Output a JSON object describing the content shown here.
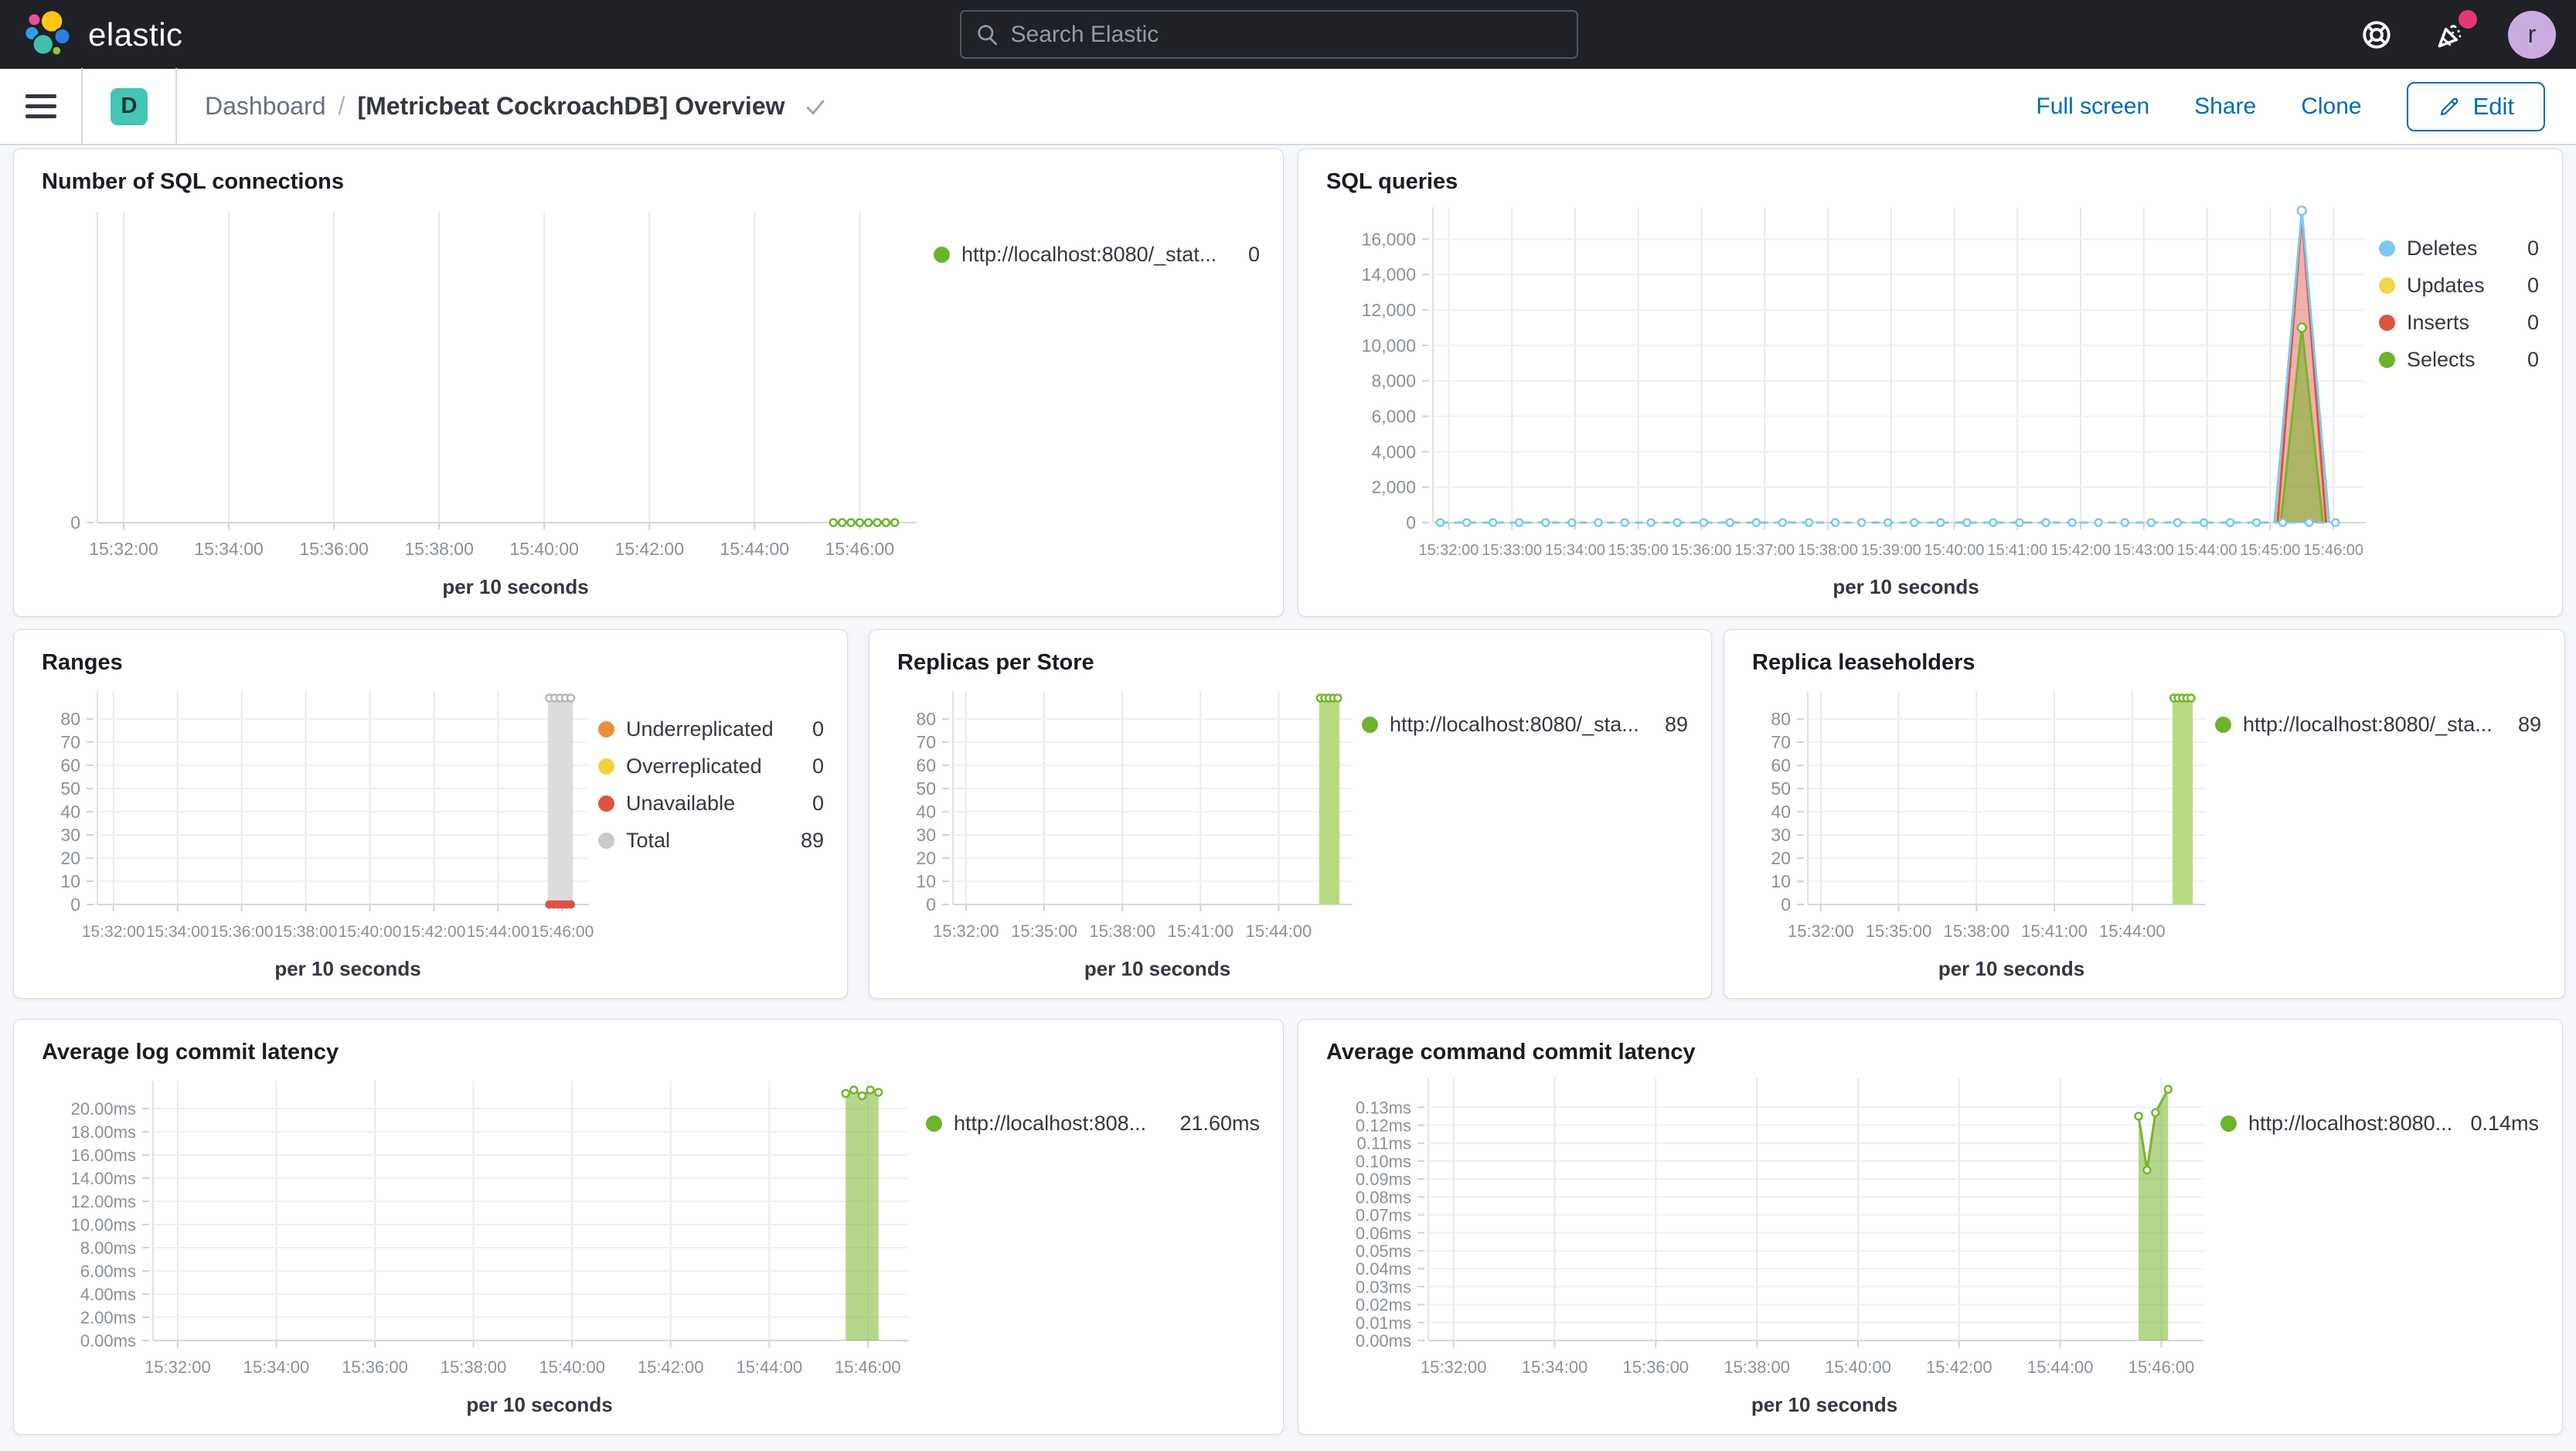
{
  "topbar": {
    "brand": "elastic",
    "search_placeholder": "Search Elastic",
    "avatar_initial": "r"
  },
  "navbar": {
    "space_initial": "D",
    "breadcrumb_root": "Dashboard",
    "breadcrumb_separator": "/",
    "title": "[Metricbeat CockroachDB] Overview",
    "actions": {
      "full_screen": "Full screen",
      "share": "Share",
      "clone": "Clone",
      "edit": "Edit"
    }
  },
  "panels": [
    {
      "id": "sql_connections",
      "title": "Number of SQL connections",
      "xlabel": "per 10 seconds",
      "legend": [
        {
          "label": "http://localhost:8080/_stat...",
          "value": "0",
          "color": "#6db32c"
        }
      ]
    },
    {
      "id": "sql_queries",
      "title": "SQL queries",
      "xlabel": "per 10 seconds",
      "legend": [
        {
          "label": "Deletes",
          "value": "0",
          "color": "#7dc8ee"
        },
        {
          "label": "Updates",
          "value": "0",
          "color": "#efd54b"
        },
        {
          "label": "Inserts",
          "value": "0",
          "color": "#dd5244"
        },
        {
          "label": "Selects",
          "value": "0",
          "color": "#6db32c"
        }
      ]
    },
    {
      "id": "ranges",
      "title": "Ranges",
      "xlabel": "per 10 seconds",
      "legend": [
        {
          "label": "Underreplicated",
          "value": "0",
          "color": "#e8913c"
        },
        {
          "label": "Overreplicated",
          "value": "0",
          "color": "#f0d33b"
        },
        {
          "label": "Unavailable",
          "value": "0",
          "color": "#dd5244"
        },
        {
          "label": "Total",
          "value": "89",
          "color": "#c9c9c9"
        }
      ]
    },
    {
      "id": "replicas_per_store",
      "title": "Replicas per Store",
      "xlabel": "per 10 seconds",
      "legend": [
        {
          "label": "http://localhost:8080/_sta...",
          "value": "89",
          "color": "#6db32c"
        }
      ]
    },
    {
      "id": "replica_leaseholders",
      "title": "Replica leaseholders",
      "xlabel": "per 10 seconds",
      "legend": [
        {
          "label": "http://localhost:8080/_sta...",
          "value": "89",
          "color": "#6db32c"
        }
      ]
    },
    {
      "id": "avg_log_commit",
      "title": "Average log commit latency",
      "xlabel": "per 10 seconds",
      "legend": [
        {
          "label": "http://localhost:808...",
          "value": "21.60ms",
          "color": "#6db32c"
        }
      ]
    },
    {
      "id": "avg_cmd_commit",
      "title": "Average command commit latency",
      "xlabel": "per 10 seconds",
      "legend": [
        {
          "label": "http://localhost:8080...",
          "value": "0.14ms",
          "color": "#6db32c"
        }
      ]
    }
  ],
  "charts": {
    "sql_connections": {
      "type": "line",
      "ylim": [
        0,
        8
      ],
      "yticks": [
        {
          "v": 0,
          "l": "0"
        }
      ],
      "xdomain": [
        "15:31:30",
        "15:47:05"
      ],
      "xticks": [
        "15:32:00",
        "15:34:00",
        "15:36:00",
        "15:38:00",
        "15:40:00",
        "15:42:00",
        "15:44:00",
        "15:46:00"
      ],
      "series": [
        {
          "name": "http://localhost:8080/_stat...",
          "type": "flat",
          "y": 0,
          "from": "15:45:30",
          "to": "15:46:40",
          "step": 10,
          "color": "#6db32c",
          "width": 3,
          "markers": "hollow"
        }
      ]
    },
    "sql_queries": {
      "type": "line",
      "ylim": [
        0,
        17800
      ],
      "yticks": [
        {
          "v": 0,
          "l": "0"
        },
        {
          "v": 2000,
          "l": "2,000"
        },
        {
          "v": 4000,
          "l": "4,000"
        },
        {
          "v": 6000,
          "l": "6,000"
        },
        {
          "v": 8000,
          "l": "8,000"
        },
        {
          "v": 10000,
          "l": "10,000"
        },
        {
          "v": 12000,
          "l": "12,000"
        },
        {
          "v": 14000,
          "l": "14,000"
        },
        {
          "v": 16000,
          "l": "16,000"
        }
      ],
      "xdomain": [
        "15:31:45",
        "15:46:30"
      ],
      "xticks": [
        "15:32:00",
        "15:33:00",
        "15:34:00",
        "15:35:00",
        "15:36:00",
        "15:37:00",
        "15:38:00",
        "15:39:00",
        "15:40:00",
        "15:41:00",
        "15:42:00",
        "15:43:00",
        "15:44:00",
        "15:45:00",
        "15:46:00"
      ],
      "series": [
        {
          "name": "Updates",
          "type": "line",
          "pts": [
            [
              "15:45:06",
              0
            ],
            [
              "15:45:30",
              17450
            ],
            [
              "15:45:54",
              0
            ]
          ],
          "color": "#efd54b",
          "width": 3
        },
        {
          "name": "Inserts",
          "type": "area",
          "pts": [
            [
              "15:45:07",
              0
            ],
            [
              "15:45:30",
              17350
            ],
            [
              "15:45:53",
              0
            ]
          ],
          "fill": "rgba(221,82,68,0.45)",
          "stroke": "#dd5244",
          "width": 3
        },
        {
          "name": "Selects",
          "type": "area",
          "pts": [
            [
              "15:45:10",
              0
            ],
            [
              "15:45:30",
              11000
            ],
            [
              "15:45:50",
              0
            ]
          ],
          "fill": "rgba(118,182,44,0.55)",
          "stroke": "#76b62c",
          "width": 3,
          "mk": [
            [
              "15:45:30",
              11000
            ]
          ]
        },
        {
          "name": "Deletes",
          "type": "flat",
          "y": 0,
          "from": "15:31:52",
          "to": "15:46:26",
          "step": 25,
          "color": "#7dc8ee",
          "width": 3,
          "dashed": true,
          "markers": "hollow"
        },
        {
          "name": "Deletes",
          "type": "line",
          "pts": [
            [
              "15:45:04",
              0
            ],
            [
              "15:45:30",
              17600
            ],
            [
              "15:45:56",
              0
            ]
          ],
          "color": "#7dc8ee",
          "width": 3,
          "mk": [
            [
              "15:45:30",
              17600
            ]
          ]
        }
      ]
    },
    "ranges": {
      "type": "bar",
      "ylim": [
        0,
        92
      ],
      "yticks": [
        {
          "v": 0,
          "l": "0"
        },
        {
          "v": 10,
          "l": "10"
        },
        {
          "v": 20,
          "l": "20"
        },
        {
          "v": 30,
          "l": "30"
        },
        {
          "v": 40,
          "l": "40"
        },
        {
          "v": 50,
          "l": "50"
        },
        {
          "v": 60,
          "l": "60"
        },
        {
          "v": 70,
          "l": "70"
        },
        {
          "v": 80,
          "l": "80"
        }
      ],
      "xdomain": [
        "15:31:30",
        "15:46:50"
      ],
      "xticks": [
        "15:32:00",
        "15:34:00",
        "15:36:00",
        "15:38:00",
        "15:40:00",
        "15:42:00",
        "15:44:00",
        "15:46:00"
      ],
      "series": [
        {
          "name": "Total",
          "type": "bar",
          "from": "15:45:33",
          "to": "15:46:20",
          "value": 89,
          "color": "#dcdcdc"
        },
        {
          "name": "Total",
          "type": "flat",
          "y": 89,
          "from": "15:45:36",
          "to": "15:46:16",
          "step": 10,
          "color": "#b9b9b9",
          "width": 0,
          "markers": "hollow"
        },
        {
          "name": "Unavailable",
          "type": "flat",
          "y": 0,
          "from": "15:45:36",
          "to": "15:46:16",
          "step": 8,
          "color": "#dd5244",
          "width": 0,
          "markers": "dot"
        }
      ]
    },
    "replicas_per_store": {
      "type": "bar",
      "ylim": [
        0,
        92
      ],
      "yticks": [
        {
          "v": 0,
          "l": "0"
        },
        {
          "v": 10,
          "l": "10"
        },
        {
          "v": 20,
          "l": "20"
        },
        {
          "v": 30,
          "l": "30"
        },
        {
          "v": 40,
          "l": "40"
        },
        {
          "v": 50,
          "l": "50"
        },
        {
          "v": 60,
          "l": "60"
        },
        {
          "v": 70,
          "l": "70"
        },
        {
          "v": 80,
          "l": "80"
        }
      ],
      "xdomain": [
        "15:31:30",
        "15:46:50"
      ],
      "xticks": [
        "15:32:00",
        "15:35:00",
        "15:38:00",
        "15:41:00",
        "15:44:00"
      ],
      "series": [
        {
          "name": "http://localhost:8080/_sta...",
          "type": "bar",
          "from": "15:45:33",
          "to": "15:46:20",
          "value": 89,
          "color": "#b7da83"
        },
        {
          "name": "http://localhost:8080/_sta...",
          "type": "flat",
          "y": 89,
          "from": "15:45:36",
          "to": "15:46:16",
          "step": 10,
          "color": "#76b62c",
          "width": 0,
          "markers": "hollow"
        }
      ]
    },
    "replica_leaseholders": {
      "type": "bar",
      "ylim": [
        0,
        92
      ],
      "yticks": [
        {
          "v": 0,
          "l": "0"
        },
        {
          "v": 10,
          "l": "10"
        },
        {
          "v": 20,
          "l": "20"
        },
        {
          "v": 30,
          "l": "30"
        },
        {
          "v": 40,
          "l": "40"
        },
        {
          "v": 50,
          "l": "50"
        },
        {
          "v": 60,
          "l": "60"
        },
        {
          "v": 70,
          "l": "70"
        },
        {
          "v": 80,
          "l": "80"
        }
      ],
      "xdomain": [
        "15:31:30",
        "15:46:50"
      ],
      "xticks": [
        "15:32:00",
        "15:35:00",
        "15:38:00",
        "15:41:00",
        "15:44:00"
      ],
      "series": [
        {
          "name": "http://localhost:8080/_sta...",
          "type": "bar",
          "from": "15:45:33",
          "to": "15:46:20",
          "value": 89,
          "color": "#b7da83"
        },
        {
          "name": "http://localhost:8080/_sta...",
          "type": "flat",
          "y": 89,
          "from": "15:45:36",
          "to": "15:46:16",
          "step": 10,
          "color": "#76b62c",
          "width": 0,
          "markers": "hollow"
        }
      ]
    },
    "avg_log_commit": {
      "type": "area",
      "ylim": [
        0,
        22.4
      ],
      "yticks": [
        {
          "v": 0,
          "l": "0.00ms"
        },
        {
          "v": 2,
          "l": "2.00ms"
        },
        {
          "v": 4,
          "l": "4.00ms"
        },
        {
          "v": 6,
          "l": "6.00ms"
        },
        {
          "v": 8,
          "l": "8.00ms"
        },
        {
          "v": 10,
          "l": "10.00ms"
        },
        {
          "v": 12,
          "l": "12.00ms"
        },
        {
          "v": 14,
          "l": "14.00ms"
        },
        {
          "v": 16,
          "l": "16.00ms"
        },
        {
          "v": 18,
          "l": "18.00ms"
        },
        {
          "v": 20,
          "l": "20.00ms"
        }
      ],
      "xdomain": [
        "15:31:30",
        "15:46:50"
      ],
      "xticks": [
        "15:32:00",
        "15:34:00",
        "15:36:00",
        "15:38:00",
        "15:40:00",
        "15:42:00",
        "15:44:00",
        "15:46:00"
      ],
      "series": [
        {
          "name": "http://localhost:808...",
          "type": "area",
          "pts": [
            [
              "15:45:33",
              21.3
            ],
            [
              "15:45:43",
              21.6
            ],
            [
              "15:45:53",
              21.1
            ],
            [
              "15:46:03",
              21.6
            ],
            [
              "15:46:13",
              21.4
            ]
          ],
          "fill": "rgba(118,182,44,0.55)",
          "stroke": "#76b62c",
          "width": 3,
          "markers": "all"
        }
      ]
    },
    "avg_cmd_commit": {
      "type": "area",
      "ylim": [
        0,
        0.1465
      ],
      "yticks": [
        {
          "v": 0,
          "l": "0.00ms"
        },
        {
          "v": 0.01,
          "l": "0.01ms"
        },
        {
          "v": 0.02,
          "l": "0.02ms"
        },
        {
          "v": 0.03,
          "l": "0.03ms"
        },
        {
          "v": 0.04,
          "l": "0.04ms"
        },
        {
          "v": 0.05,
          "l": "0.05ms"
        },
        {
          "v": 0.06,
          "l": "0.06ms"
        },
        {
          "v": 0.07,
          "l": "0.07ms"
        },
        {
          "v": 0.08,
          "l": "0.08ms"
        },
        {
          "v": 0.09,
          "l": "0.09ms"
        },
        {
          "v": 0.1,
          "l": "0.10ms"
        },
        {
          "v": 0.11,
          "l": "0.11ms"
        },
        {
          "v": 0.12,
          "l": "0.12ms"
        },
        {
          "v": 0.13,
          "l": "0.13ms"
        }
      ],
      "xdomain": [
        "15:31:30",
        "15:46:50"
      ],
      "xticks": [
        "15:32:00",
        "15:34:00",
        "15:36:00",
        "15:38:00",
        "15:40:00",
        "15:42:00",
        "15:44:00",
        "15:46:00"
      ],
      "series": [
        {
          "name": "http://localhost:8080...",
          "type": "area",
          "pts": [
            [
              "15:45:33",
              0.125
            ],
            [
              "15:45:43",
              0.095
            ],
            [
              "15:45:53",
              0.127
            ],
            [
              "15:46:08",
              0.14
            ]
          ],
          "fill": "rgba(118,182,44,0.55)",
          "stroke": "#76b62c",
          "width": 3,
          "markers": "all"
        }
      ]
    }
  }
}
